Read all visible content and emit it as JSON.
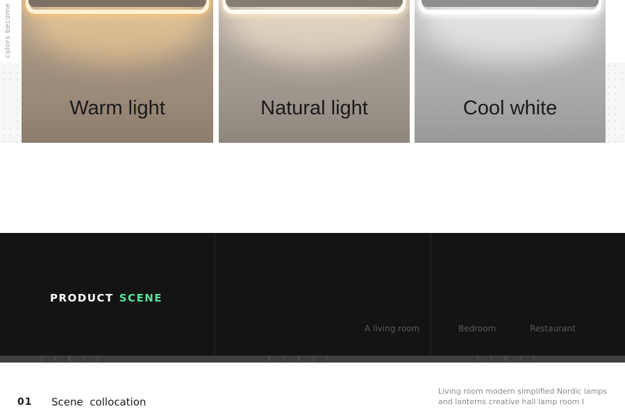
{
  "side_caption": "colors become",
  "light_panels": [
    {
      "label": "Warm light"
    },
    {
      "label": "Natural light"
    },
    {
      "label": "Cool white"
    }
  ],
  "scene": {
    "title_primary": "PRODUCT",
    "title_accent": "SCENE",
    "accent_color": "#5ae29a",
    "tags": [
      "A living room",
      "Bedroom",
      "Restaurant"
    ]
  },
  "section": {
    "number": "01",
    "label": "Scene  collocation",
    "description": "Living room modern simplified Nordic lamps and lanterns creative hall lamp room l"
  },
  "stripe_marks": [
    "/ / X / /",
    "X / X / /",
    "/ / X / /"
  ]
}
